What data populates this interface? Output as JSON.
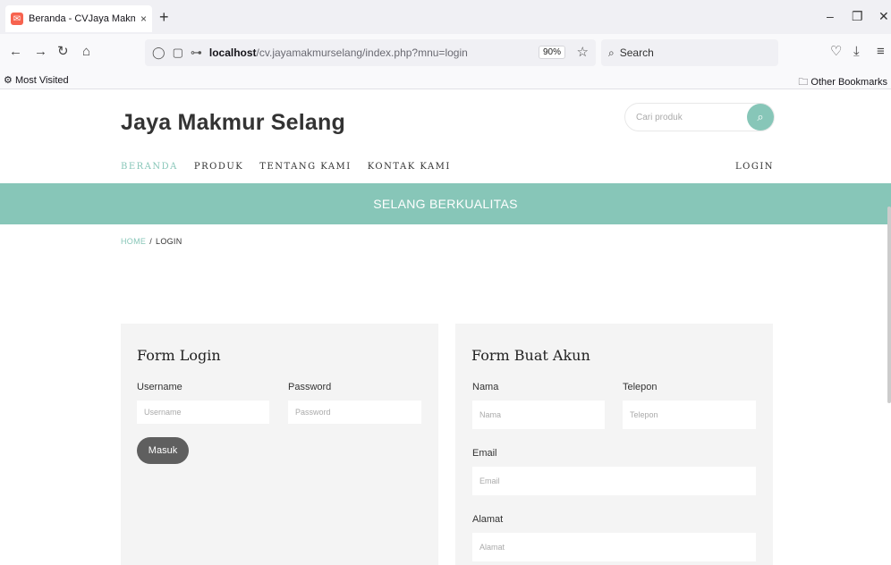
{
  "browser": {
    "tab_title": "Beranda - CVJaya Makmur Sela",
    "tab_close": "×",
    "new_tab": "+",
    "url_host": "localhost",
    "url_path": "/cv.jayamakmurselang/index.php?mnu=login",
    "zoom": "90%",
    "search_label": "Search",
    "bookmarks": {
      "most_visited": "Most Visited",
      "other": "Other Bookmarks"
    }
  },
  "site": {
    "brand": "Jaya Makmur Selang",
    "search_placeholder": "Cari produk",
    "menu": [
      "BERANDA",
      "PRODUK",
      "TENTANG KAMI",
      "KONTAK KAMI"
    ],
    "login_link": "LOGIN",
    "banner": "SELANG BERKUALITAS",
    "breadcrumb": {
      "home": "HOME",
      "separator": "/",
      "current": "LOGIN"
    }
  },
  "login_form": {
    "title": "Form Login",
    "username_label": "Username",
    "username_placeholder": "Username",
    "password_label": "Password",
    "password_placeholder": "Password",
    "submit": "Masuk"
  },
  "register_form": {
    "title": "Form Buat Akun",
    "nama_label": "Nama",
    "nama_placeholder": "Nama",
    "telepon_label": "Telepon",
    "telepon_placeholder": "Telepon",
    "email_label": "Email",
    "email_placeholder": "Email",
    "alamat_label": "Alamat",
    "alamat_placeholder": "Alamat"
  },
  "colors": {
    "accent": "#87c6b8",
    "button": "#5f5f5f",
    "panel": "#f4f4f4"
  }
}
